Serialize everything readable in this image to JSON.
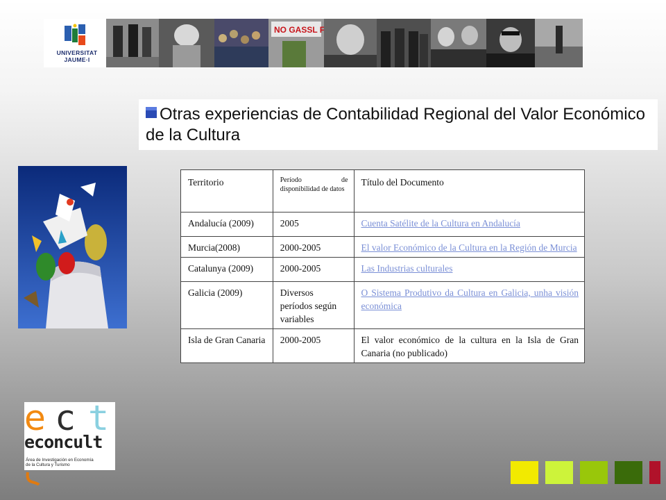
{
  "header": {
    "logo_line1": "UNIVERSITAT",
    "logo_line2": "JAUME·I"
  },
  "title": "Otras experiencias de Contabilidad Regional del Valor Económico de la Cultura",
  "table": {
    "headers": [
      "Territorio",
      "Período de disponibilidad de datos",
      "Título del Documento"
    ],
    "rows": [
      {
        "territorio": "Andalucía (2009)",
        "periodo": "2005",
        "titulo": "Cuenta Satélite de la Cultura en Andalucía",
        "link": true
      },
      {
        "territorio": "Murcia(2008)",
        "periodo": "2000-2005",
        "titulo": "El valor Económico de la Cultura en la Región de Murcia",
        "link": true
      },
      {
        "territorio": "Catalunya (2009)",
        "periodo": "2000-2005",
        "titulo": "Las Industrias culturales",
        "link": true
      },
      {
        "territorio": "Galicia (2009)",
        "periodo": "Diversos períodos según variables",
        "titulo": "O Sistema Produtivo da Cultura en Galicia, unha visión económica",
        "link": true
      },
      {
        "territorio": "Isla de Gran Canaria",
        "periodo": "2000-2005",
        "titulo": "El valor económico de la cultura en la Isla de Gran Canaria (no publicado)",
        "link": false
      }
    ]
  },
  "econcult": {
    "letters": "ect",
    "word": "econcult",
    "subtitle_line1": "Área de Investigación en Economía",
    "subtitle_line2": "de la Cultura y Turismo"
  },
  "colors": {
    "title_bullet": "#2a4bb5",
    "link": "#7a8fd6",
    "squares": [
      "#f2ea00",
      "#cdf33a",
      "#99c70a",
      "#3a6b0a",
      "#b0122a"
    ]
  }
}
